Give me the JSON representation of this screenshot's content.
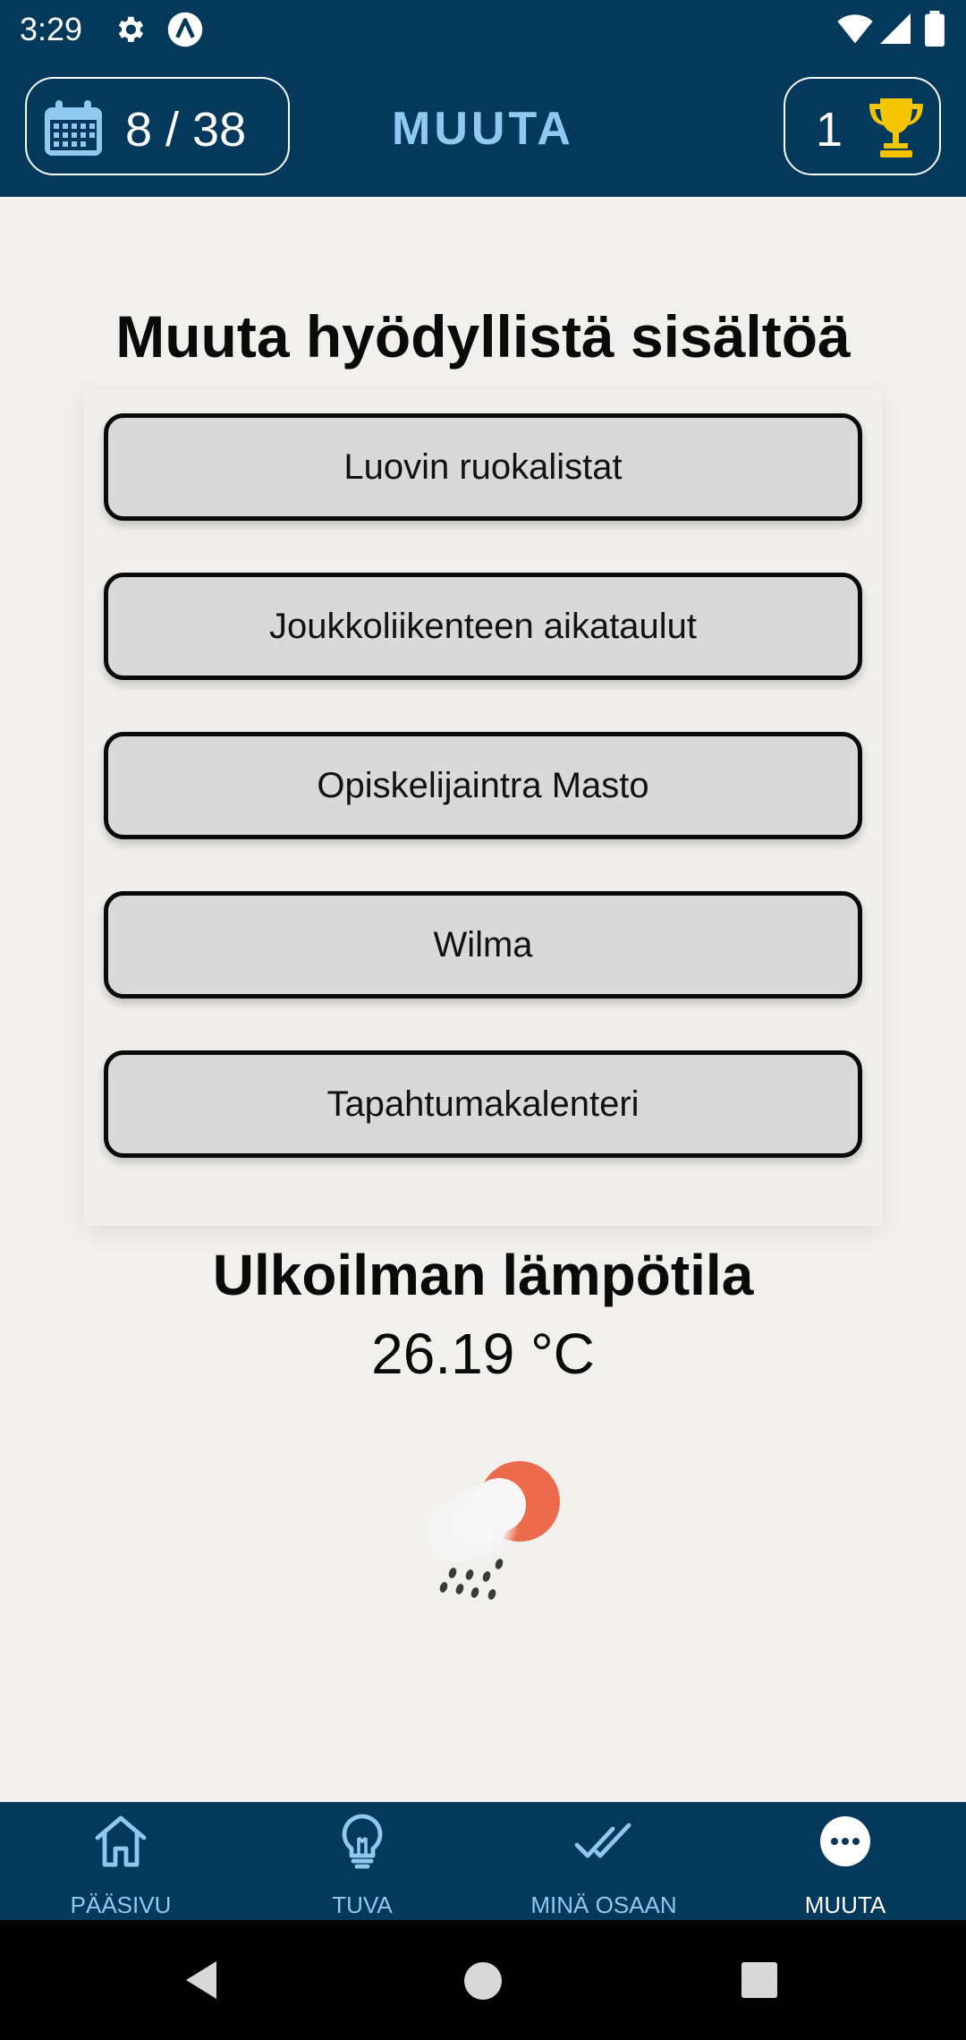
{
  "status_bar": {
    "time": "3:29",
    "icons": [
      "gear-icon",
      "a-badge-icon",
      "wifi-icon",
      "signal-icon",
      "battery-icon"
    ]
  },
  "header": {
    "day_counter": "8 / 38",
    "title": "MUUTA",
    "trophy_count": "1",
    "colors": {
      "background": "#05395c",
      "title": "#8fc9f0",
      "trophy": "#f2c500"
    }
  },
  "content": {
    "section_title": "Muuta hyödyllistä sisältöä",
    "links": [
      "Luovin ruokalistat",
      "Joukkoliikenteen aikataulut",
      "Opiskelijaintra Masto",
      "Wilma",
      "Tapahtumakalenteri"
    ],
    "temperature_title": "Ulkoilman lämpötila",
    "temperature_value": "26.19 °C",
    "weather_icon": "partly-cloudy-rain-icon"
  },
  "bottom_nav": {
    "items": [
      {
        "label": "PÄÄSIVU",
        "icon": "home-icon"
      },
      {
        "label": "TUVA",
        "icon": "lightbulb-icon"
      },
      {
        "label": "MINÄ OSAAN",
        "icon": "double-check-icon"
      },
      {
        "label": "MUUTA",
        "icon": "more-icon",
        "active": true
      }
    ]
  }
}
